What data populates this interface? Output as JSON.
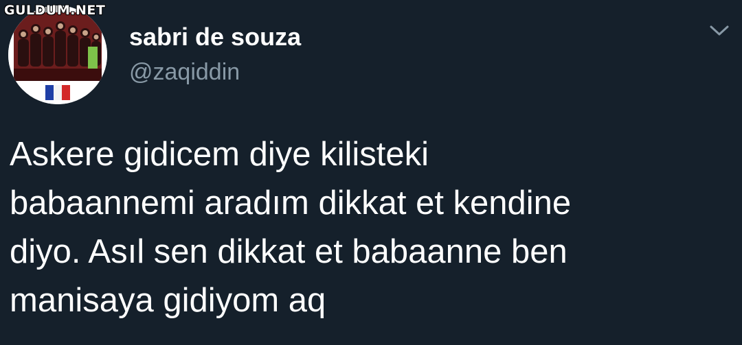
{
  "watermark": {
    "text": "GULDUM.NET"
  },
  "tweet": {
    "author": {
      "display_name": "sabri de souza",
      "handle": "@zaqiddin",
      "avatar_icon": "profile-photo-group-with-french-flag"
    },
    "menu_icon": "chevron-down-icon",
    "text_lines": [
      "Askere gidicem diye kilisteki",
      "babaannemi aradım dikkat et kendine",
      "diyo. Asıl sen dikkat et babaanne ben",
      "manisaya gidiyom aq"
    ]
  },
  "colors": {
    "background": "#15202b",
    "primary_text": "#ffffff",
    "secondary_text": "#8899a6"
  }
}
